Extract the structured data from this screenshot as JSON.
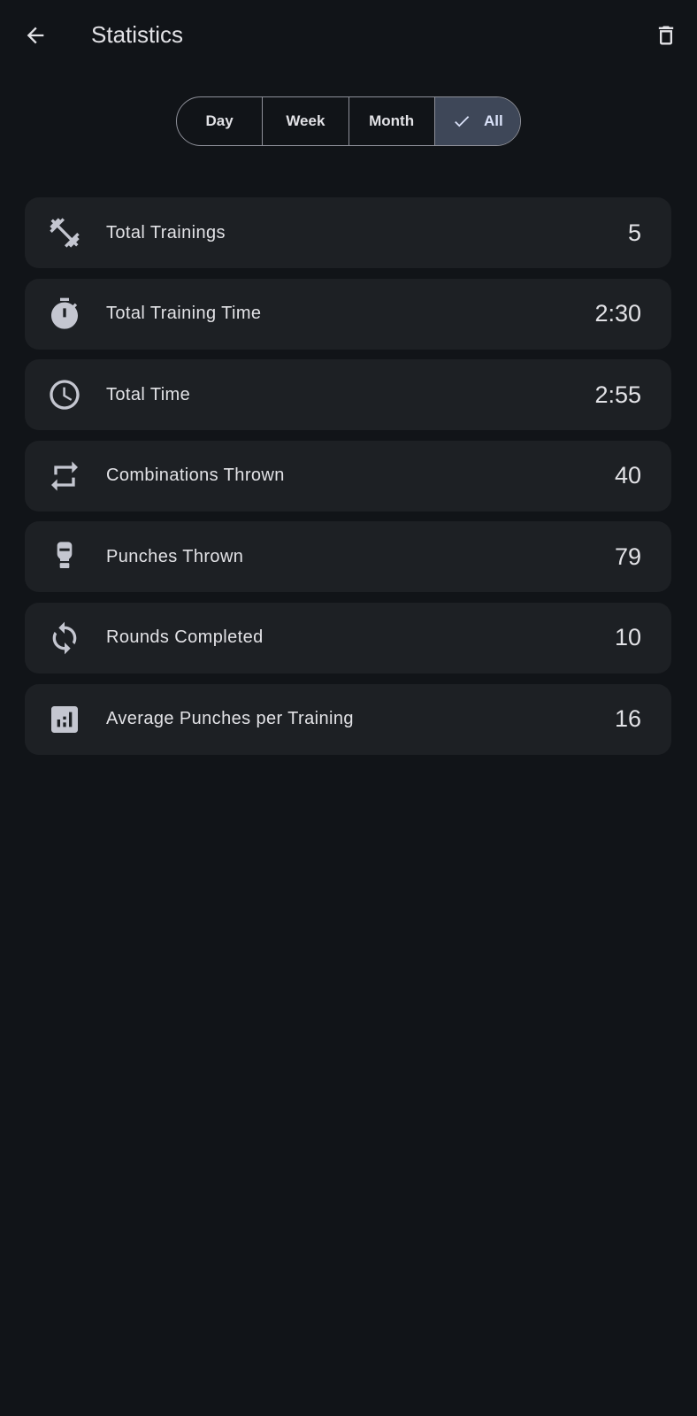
{
  "header": {
    "title": "Statistics",
    "back_icon": "arrow-back-icon",
    "delete_icon": "delete-icon"
  },
  "filters": {
    "options": [
      "Day",
      "Week",
      "Month",
      "All"
    ],
    "selected": "All"
  },
  "stats": [
    {
      "label": "Total Trainings",
      "value": "5",
      "icon": "dumbbell-icon"
    },
    {
      "label": "Total Training Time",
      "value": "2:30",
      "icon": "stopwatch-icon"
    },
    {
      "label": "Total Time",
      "value": "2:55",
      "icon": "clock-icon"
    },
    {
      "label": "Combinations Thrown",
      "value": "40",
      "icon": "repeat-icon"
    },
    {
      "label": "Punches Thrown",
      "value": "79",
      "icon": "boxing-glove-icon"
    },
    {
      "label": "Rounds Completed",
      "value": "10",
      "icon": "sync-icon"
    },
    {
      "label": "Average Punches per Training",
      "value": "16",
      "icon": "bar-chart-icon"
    }
  ],
  "colors": {
    "background": "#111418",
    "card": "#1d2024",
    "selected_segment": "#3e4758",
    "text": "#e2e2e6",
    "icon": "#c4c6d0"
  }
}
